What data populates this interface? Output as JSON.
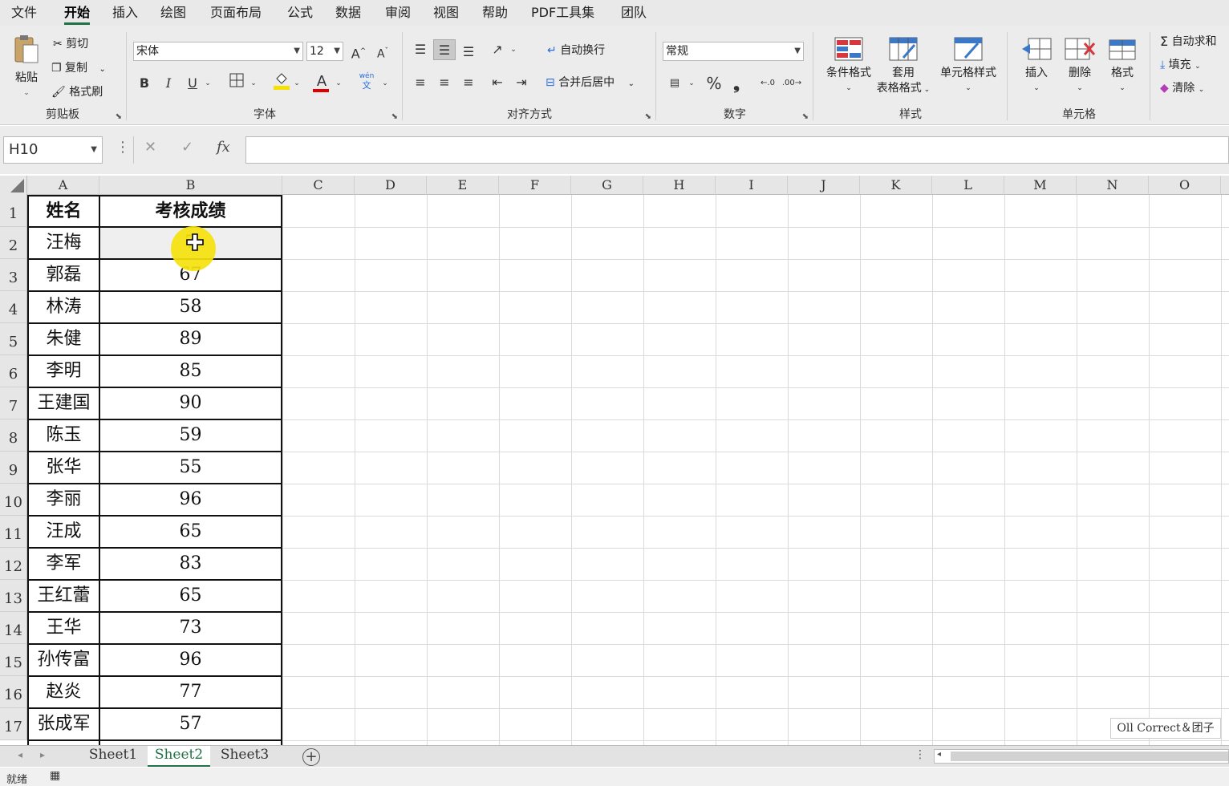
{
  "menu": {
    "items": [
      "文件",
      "开始",
      "插入",
      "绘图",
      "页面布局",
      "公式",
      "数据",
      "审阅",
      "视图",
      "帮助",
      "PDF工具集",
      "团队"
    ],
    "active": "开始"
  },
  "ribbon": {
    "clipboard": {
      "paste": "粘贴",
      "cut": "剪切",
      "copy": "复制",
      "format_painter": "格式刷",
      "label": "剪贴板"
    },
    "font": {
      "name": "宋体",
      "size": "12",
      "grow": "A",
      "shrink": "A",
      "bold": "B",
      "italic": "I",
      "underline": "U",
      "phonetic_top": "wén",
      "phonetic_bottom": "文",
      "font_color_letter": "A",
      "label": "字体"
    },
    "alignment": {
      "wrap_text": "自动换行",
      "merge_center": "合并后居中",
      "label": "对齐方式"
    },
    "number": {
      "format": "常规",
      "percent": "%",
      "comma": "❟",
      "label": "数字"
    },
    "styles": {
      "conditional": "条件格式",
      "table_top": "套用",
      "table_bottom": "表格格式",
      "cell_styles": "单元格样式",
      "label": "样式"
    },
    "cells": {
      "insert": "插入",
      "delete": "删除",
      "format": "格式",
      "label": "单元格"
    },
    "editing": {
      "autosum": "自动求和",
      "fill": "填充",
      "clear": "清除"
    },
    "colors": {
      "highlight": "#f5e000",
      "font_color": "#e00000",
      "accent": "#217346"
    }
  },
  "formula_bar": {
    "name_box": "H10",
    "cancel": "✕",
    "enter": "✓",
    "fx": "fx",
    "value": ""
  },
  "sheet": {
    "column_headers": [
      "A",
      "B",
      "C",
      "D",
      "E",
      "F",
      "G",
      "H",
      "I",
      "J",
      "K",
      "L",
      "M",
      "N",
      "O"
    ],
    "row_numbers": [
      "1",
      "2",
      "3",
      "4",
      "5",
      "6",
      "7",
      "8",
      "9",
      "10",
      "11",
      "12",
      "13",
      "14",
      "15",
      "16",
      "17"
    ],
    "header": [
      "姓名",
      "考核成绩"
    ],
    "rows": [
      [
        "汪梅",
        "7"
      ],
      [
        "郭磊",
        "67"
      ],
      [
        "林涛",
        "58"
      ],
      [
        "朱健",
        "89"
      ],
      [
        "李明",
        "85"
      ],
      [
        "王建国",
        "90"
      ],
      [
        "陈玉",
        "59"
      ],
      [
        "张华",
        "55"
      ],
      [
        "李丽",
        "96"
      ],
      [
        "汪成",
        "65"
      ],
      [
        "李军",
        "83"
      ],
      [
        "王红蕾",
        "65"
      ],
      [
        "王华",
        "73"
      ],
      [
        "孙传富",
        "96"
      ],
      [
        "赵炎",
        "77"
      ],
      [
        "张成军",
        "57"
      ]
    ]
  },
  "watermark": "Oll Correct＆团子",
  "tabs": {
    "sheets": [
      "Sheet1",
      "Sheet2",
      "Sheet3"
    ],
    "active": "Sheet2",
    "add": "+"
  },
  "status": {
    "ready": "就绪"
  }
}
